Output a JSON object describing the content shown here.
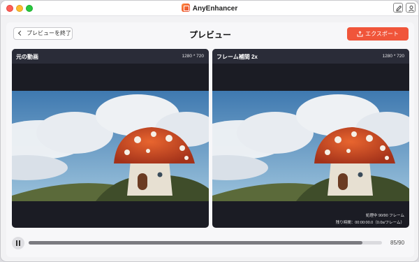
{
  "window": {
    "app_title": "AnyEnhancer"
  },
  "toolbar": {
    "back_label": "プレビューを終了",
    "page_title": "プレビュー",
    "export_label": "エクスポート"
  },
  "colors": {
    "accent": "#f0553a",
    "card_bg": "#1b1c24",
    "card_header": "#2a2c38"
  },
  "icons": {
    "back": "chevron-left-icon",
    "export": "export-icon",
    "edit": "edit-icon",
    "user": "user-icon",
    "pause": "pause-icon"
  },
  "videos": [
    {
      "title": "元の動画",
      "resolution": "1280 * 720"
    },
    {
      "title": "フレーム補間 2x",
      "resolution": "1280 * 720",
      "status_frames": "処理中 90/90 フレーム",
      "status_time": "残り時間：00:00:00.0（0.0s/フレーム）"
    }
  ],
  "playback": {
    "progress_fraction": 0.944,
    "counter": "85/90"
  }
}
